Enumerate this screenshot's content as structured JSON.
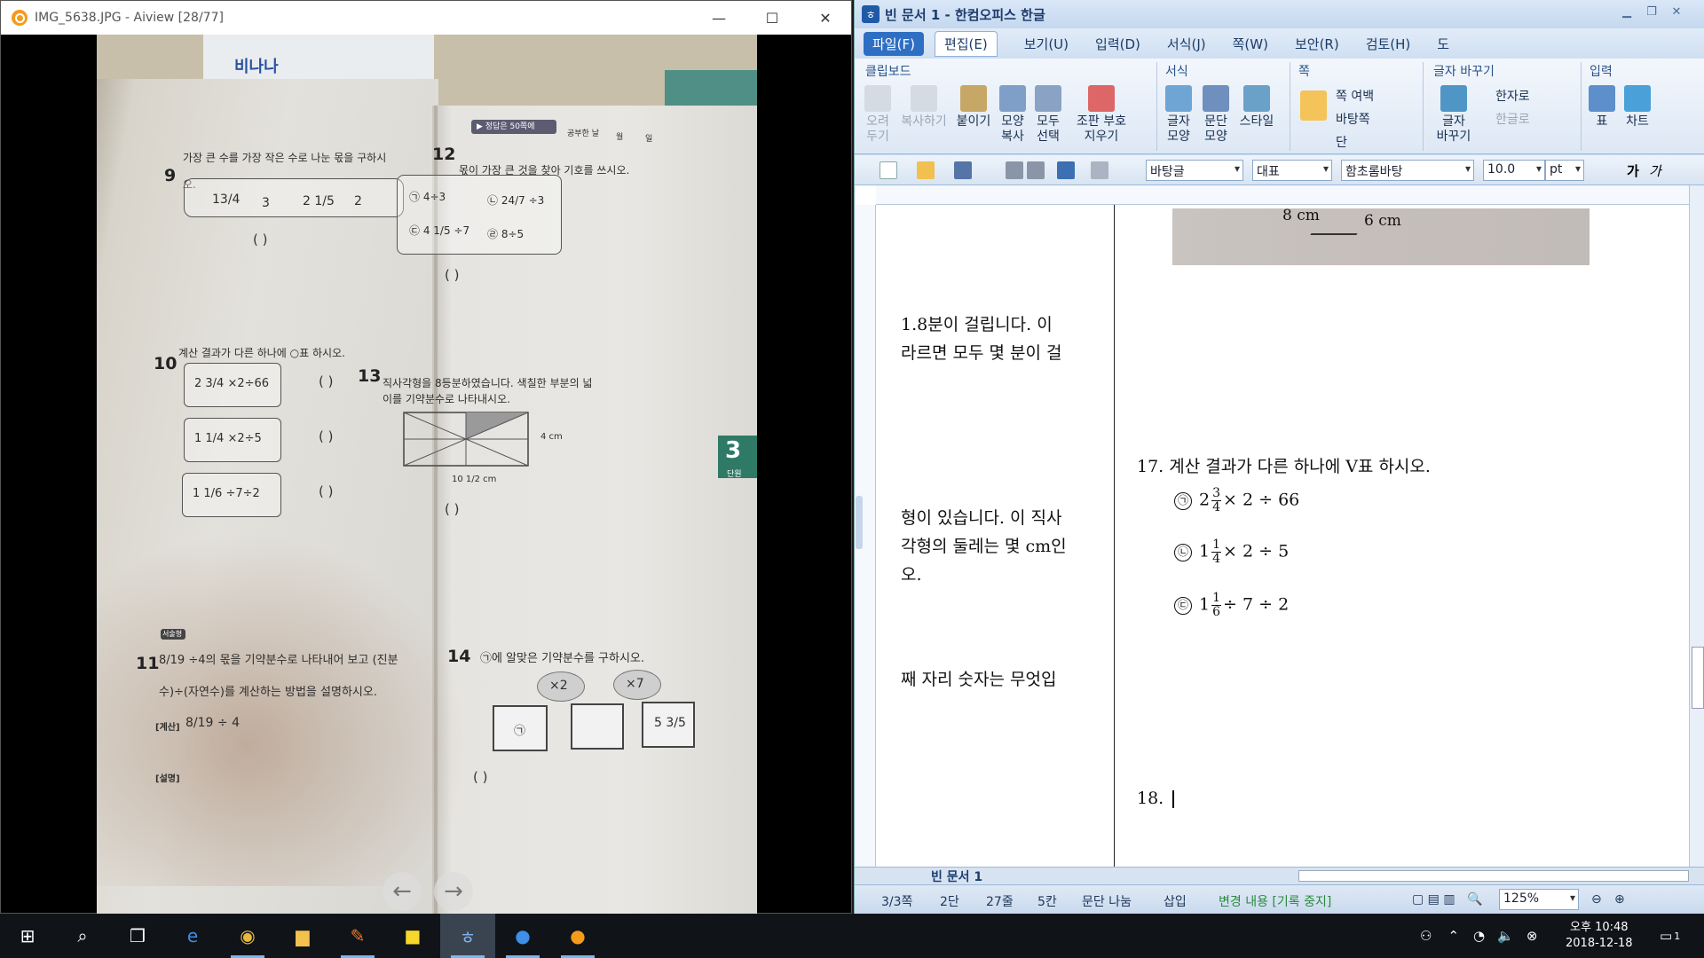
{
  "aiview": {
    "title": "IMG_5638.JPG - Aiview [28/77]",
    "minimize": "—",
    "maximize": "☐",
    "close": "✕",
    "prev": "←",
    "next": "→"
  },
  "photo": {
    "header_tag": "▶ 정답은 50쪽에",
    "header_study": "공부한 날",
    "header_month": "월",
    "header_day": "일",
    "brand": "비나나",
    "unit_badge": "3",
    "unit_label": "단원",
    "q9": {
      "num": "9",
      "text1": "가장 큰 수를 가장 작은 수로 나눈 몫을 구하시",
      "text2": "오.",
      "items": [
        "13/4",
        "3",
        "2 1/5",
        "2"
      ],
      "paren": "(                    )"
    },
    "q10": {
      "num": "10",
      "text": "계산 결과가 다른 하나에 ○표 하시오.",
      "rows": [
        "2 3/4 ×2÷66",
        "1 1/4 ×2÷5",
        "1 1/6 ÷7÷2"
      ],
      "paren": "(          )"
    },
    "q11": {
      "num": "11",
      "tag": "서술형",
      "text1": "8/19 ÷4의 몫을 기약분수로 나타내어 보고 (진분",
      "text2": "수)÷(자연수)를 계산하는 방법을 설명하시오.",
      "calc_label": "[계산]",
      "calc": "8/19 ÷ 4",
      "explain_label": "[설명]"
    },
    "q12": {
      "num": "12",
      "text": "몫이 가장 큰 것을 찾아 기호를 쓰시오.",
      "items": [
        "㉠ 4÷3",
        "㉡ 24/7 ÷3",
        "㉢ 4 1/5 ÷7",
        "㉣ 8÷5"
      ],
      "paren": "(                    )"
    },
    "q13": {
      "num": "13",
      "text1": "직사각형을 8등분하였습니다. 색칠한 부분의 넓",
      "text2": "이를 기약분수로 나타내시오.",
      "height": "4 cm",
      "width": "10 1/2 cm",
      "paren": "(                    )"
    },
    "q14": {
      "num": "14",
      "text": "㉠에 알맞은 기약분수를 구하시오.",
      "op1": "×2",
      "op2": "×7",
      "box1": "㉠",
      "box3": "5 3/5",
      "paren": "(                    )"
    }
  },
  "hwp": {
    "title": "빈 문서 1 - 한컴오피스 한글",
    "menus": [
      "파일(F)",
      "편집(E)",
      "보기(U)",
      "입력(D)",
      "서식(J)",
      "쪽(W)",
      "보안(R)",
      "검토(H)",
      "도"
    ],
    "ribbon": {
      "groups": [
        "클립보드",
        "서식",
        "쪽",
        "글자 바꾸기",
        "입력"
      ],
      "clipboard": [
        "오려\n두기",
        "복사하기",
        "붙이기",
        "모양\n복사",
        "모두\n선택",
        "조판 부호\n지우기"
      ],
      "format": [
        "글자\n모양",
        "문단\n모양",
        "스타일"
      ],
      "page": [
        "쪽 여백",
        "바탕쪽",
        "단"
      ],
      "charswap": [
        "글자\n바꾸기",
        "한자로",
        "한글로"
      ],
      "insert": [
        "표",
        "차트"
      ]
    },
    "toolbar": {
      "style": "바탕글",
      "lang": "대표",
      "font": "함초롬바탕",
      "size": "10.0",
      "unit": "pt",
      "bold": "가",
      "italic": "가"
    },
    "left_col": {
      "l1": "1.8분이 걸립니다. 이",
      "l2": "라르면 모두 몇 분이 걸",
      "l3": "형이 있습니다. 이 직사",
      "l4": "각형의 둘레는 몇 cm인",
      "l5": "오.",
      "l6": "째 자리 숫자는 무엇입"
    },
    "image_labels": {
      "a": "8 cm",
      "b": "6 cm"
    },
    "q17": {
      "title": "17. 계산 결과가 다른 하나에 V표 하시오.",
      "items": [
        {
          "mark": "㉠",
          "whole": "2",
          "num": "3",
          "den": "4",
          "rest": "× 2 ÷ 66"
        },
        {
          "mark": "㉡",
          "whole": "1",
          "num": "1",
          "den": "4",
          "rest": "× 2 ÷ 5"
        },
        {
          "mark": "㉢",
          "whole": "1",
          "num": "1",
          "den": "6",
          "rest": "÷ 7 ÷ 2"
        }
      ]
    },
    "q18": "18.",
    "tab_name": "빈 문서 1",
    "status": {
      "page": "3/3쪽",
      "col": "2단",
      "line": "27줄",
      "char": "5칸",
      "break": "문단 나눔",
      "mode": "삽입",
      "track": "변경 내용 [기록 중지]",
      "zoom": "125%"
    }
  },
  "taskbar": {
    "time": "오후 10:48",
    "date": "2018-12-18",
    "notif": "1"
  }
}
